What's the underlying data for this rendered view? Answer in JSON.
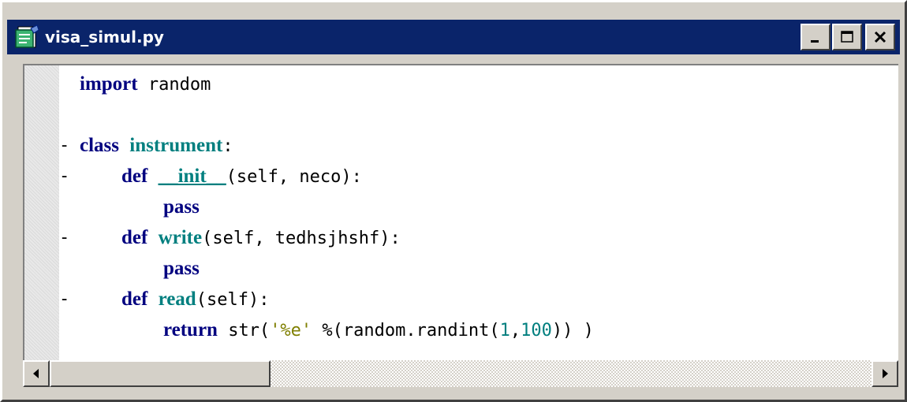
{
  "window": {
    "title": "visa_simul.py",
    "icon": "python-file-icon",
    "buttons": [
      "minimize",
      "maximize",
      "close"
    ]
  },
  "editor": {
    "lines": [
      {
        "fold": "",
        "tokens": [
          {
            "t": "import",
            "c": "kw"
          },
          {
            "t": " random",
            "c": ""
          }
        ]
      },
      {
        "fold": "",
        "tokens": []
      },
      {
        "fold": "-",
        "tokens": [
          {
            "t": "class",
            "c": "kw"
          },
          {
            "t": " ",
            "c": ""
          },
          {
            "t": "instrument",
            "c": "nm"
          },
          {
            "t": ":",
            "c": ""
          }
        ]
      },
      {
        "fold": "-",
        "tokens": [
          {
            "t": "    ",
            "c": ""
          },
          {
            "t": "def",
            "c": "kw"
          },
          {
            "t": " ",
            "c": ""
          },
          {
            "t": "__init__",
            "c": "nm und"
          },
          {
            "t": "(self, neco):",
            "c": ""
          }
        ]
      },
      {
        "fold": "",
        "tokens": [
          {
            "t": "        ",
            "c": ""
          },
          {
            "t": "pass",
            "c": "kw"
          }
        ]
      },
      {
        "fold": "-",
        "tokens": [
          {
            "t": "    ",
            "c": ""
          },
          {
            "t": "def",
            "c": "kw"
          },
          {
            "t": " ",
            "c": ""
          },
          {
            "t": "write",
            "c": "nm"
          },
          {
            "t": "(self, tedhsjhshf):",
            "c": ""
          }
        ]
      },
      {
        "fold": "",
        "tokens": [
          {
            "t": "        ",
            "c": ""
          },
          {
            "t": "pass",
            "c": "kw"
          }
        ]
      },
      {
        "fold": "-",
        "tokens": [
          {
            "t": "    ",
            "c": ""
          },
          {
            "t": "def",
            "c": "kw"
          },
          {
            "t": " ",
            "c": ""
          },
          {
            "t": "read",
            "c": "nm"
          },
          {
            "t": "(self):",
            "c": ""
          }
        ]
      },
      {
        "fold": "",
        "tokens": [
          {
            "t": "        ",
            "c": ""
          },
          {
            "t": "return",
            "c": "kw"
          },
          {
            "t": " str(",
            "c": ""
          },
          {
            "t": "'%e'",
            "c": "str"
          },
          {
            "t": " %(random.randint(",
            "c": ""
          },
          {
            "t": "1",
            "c": "num"
          },
          {
            "t": ",",
            "c": ""
          },
          {
            "t": "100",
            "c": "num"
          },
          {
            "t": ")) )",
            "c": ""
          }
        ]
      }
    ]
  },
  "scrollbar": {
    "left_icon": "arrow-left-icon",
    "right_icon": "arrow-right-icon"
  },
  "colors": {
    "titlebar": "#0a246a",
    "keyword": "#00007f",
    "name": "#007f7f",
    "string": "#7f7f00",
    "number": "#007f7f"
  }
}
